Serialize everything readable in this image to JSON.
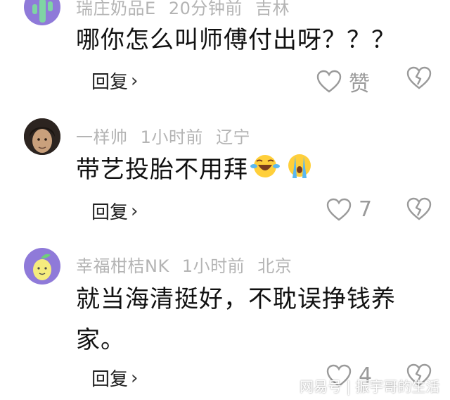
{
  "comments": [
    {
      "meta": {
        "name": "瑞庄奶品E",
        "time": "20分钟前",
        "location": "吉林"
      },
      "text": "哪你怎么叫师傅付出呀？？？",
      "reply_label": "回复",
      "like": {
        "label": "赞",
        "count": ""
      },
      "avatar_icon": "cactus-avatar-icon"
    },
    {
      "meta": {
        "name": "一样帅",
        "time": "1小时前",
        "location": "辽宁"
      },
      "text": "带艺投胎不用拜",
      "emojis": [
        "laughing-crying-emoji",
        "crying-emoji"
      ],
      "reply_label": "回复",
      "like": {
        "label": "",
        "count": "7"
      },
      "avatar_icon": "man-portrait-avatar"
    },
    {
      "meta": {
        "name": "幸福柑桔NK",
        "time": "1小时前",
        "location": "北京"
      },
      "text_line1": "就当海清挺好，不耽误挣钱养",
      "text_line2": "家。",
      "reply_label": "回复",
      "like": {
        "label": "",
        "count": "4"
      },
      "avatar_icon": "lemon-avatar-icon"
    }
  ],
  "watermark": "网易号 | 振宇哥的生活",
  "colors": {
    "meta_text": "#b4b4b4",
    "icon_stroke": "#9a9a9a",
    "accent_purple": "#8f7ad9"
  }
}
